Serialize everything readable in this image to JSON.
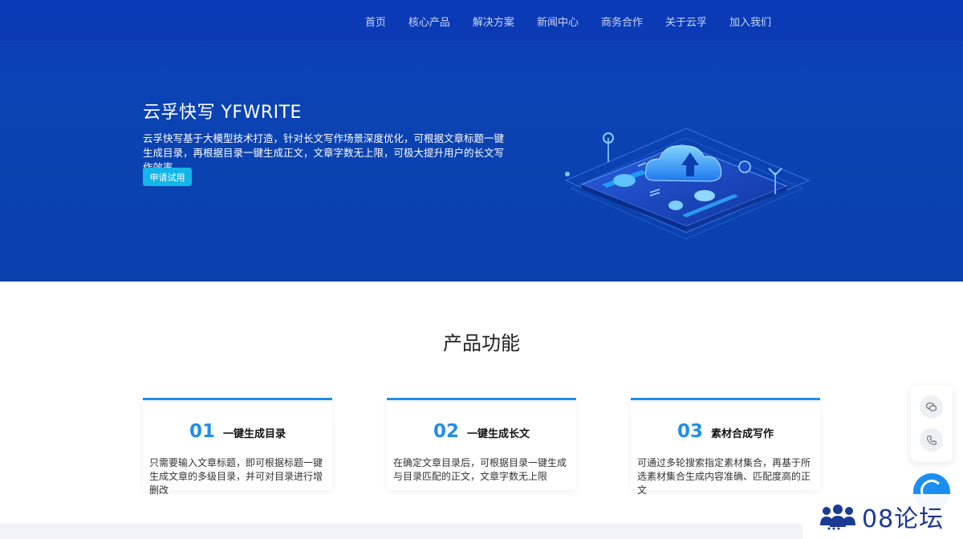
{
  "nav": {
    "items": [
      {
        "label": "首页"
      },
      {
        "label": "核心产品"
      },
      {
        "label": "解决方案"
      },
      {
        "label": "新闻中心"
      },
      {
        "label": "商务合作"
      },
      {
        "label": "关于云孚"
      },
      {
        "label": "加入我们"
      }
    ]
  },
  "hero": {
    "title": "云孚快写 YFWRITE",
    "description": "云孚快写基于大模型技术打造，针对长文写作场景深度优化，可根据文章标题一键生成目录，再根据目录一键生成正文，文章字数无上限，可极大提升用户的长文写作效率。",
    "button_label": "申请试用",
    "illustration_icon": "cloud-upload-icon"
  },
  "features": {
    "title": "产品功能",
    "cards": [
      {
        "num": "01",
        "title": "一键生成目录",
        "text": "只需要输入文章标题，即可根据标题一键生成文章的多级目录，并可对目录进行增删改"
      },
      {
        "num": "02",
        "title": "一键生成长文",
        "text": "在确定文章目录后，可根据目录一键生成与目录匹配的正文，文章字数无上限"
      },
      {
        "num": "03",
        "title": "素材合成写作",
        "text": "可通过多轮搜索指定素材集合，再基于所选素材集合生成内容准确、匹配度高的正文"
      }
    ]
  },
  "side": {
    "chat_icon": "chat-icon",
    "phone_icon": "phone-icon"
  },
  "watermark": {
    "text": "08论坛"
  },
  "colors": {
    "hero_bg": "#0b43b3",
    "accent": "#1f8ee8",
    "button": "#14b6ea"
  }
}
